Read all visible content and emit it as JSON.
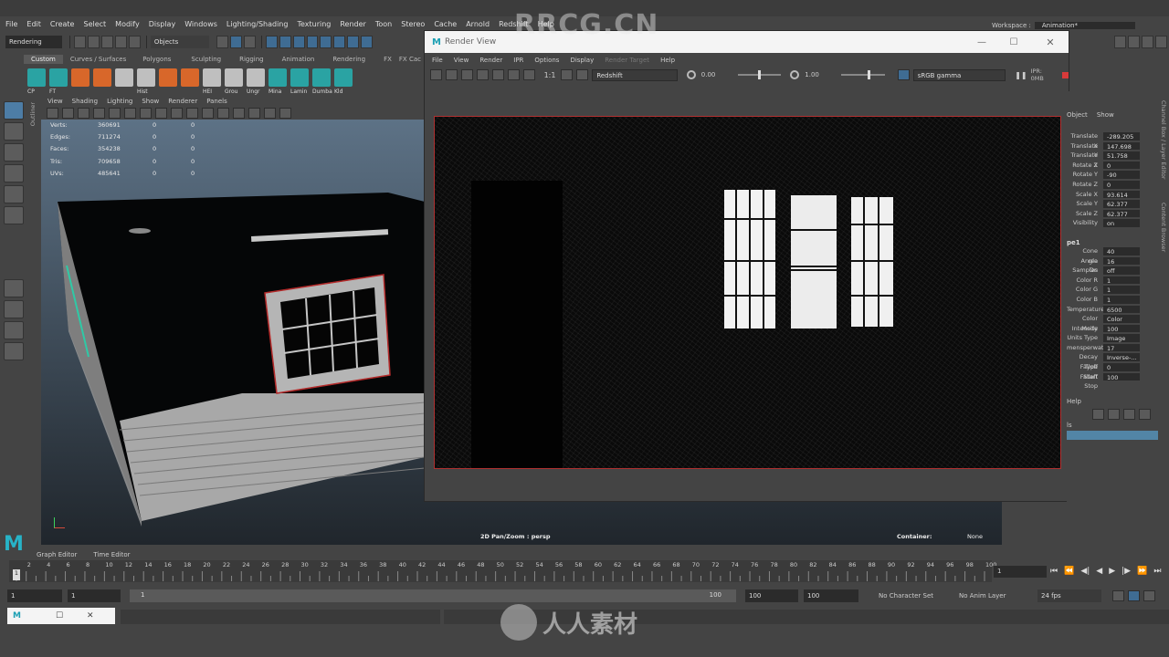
{
  "app": {
    "menus": [
      "File",
      "Edit",
      "Create",
      "Select",
      "Modify",
      "Display",
      "Windows",
      "Lighting/Shading",
      "Texturing",
      "Render",
      "Toon",
      "Stereo",
      "Cache",
      "Arnold",
      "Redshift",
      "Help"
    ],
    "workspace_label": "Workspace :",
    "workspace_value": "Animation*"
  },
  "status_line": {
    "menu_set": "Rendering",
    "selection_mode": "Objects"
  },
  "shelf": {
    "tabs": [
      "Custom",
      "Curves / Surfaces",
      "Polygons",
      "Sculpting",
      "Rigging",
      "Animation",
      "Rendering",
      "FX",
      "FX Cac"
    ],
    "active_tab": "Custom",
    "buttons": [
      "CP",
      "FT",
      "",
      "",
      "",
      "Hist",
      "",
      "",
      "HEI",
      "Grou",
      "Ungr",
      "Mina",
      "Lamin",
      "Dumba",
      "Kld"
    ]
  },
  "side_tabs": {
    "outliner": "Outliner",
    "channel_box": "Channel Box / Layer Editor",
    "content_browser": "Content Browser"
  },
  "viewport": {
    "menus": [
      "View",
      "Shading",
      "Lighting",
      "Show",
      "Renderer",
      "Panels"
    ],
    "hud": [
      {
        "label": "Verts:",
        "a": "360691",
        "b": "0",
        "c": "0"
      },
      {
        "label": "Edges:",
        "a": "711274",
        "b": "0",
        "c": "0"
      },
      {
        "label": "Faces:",
        "a": "354238",
        "b": "0",
        "c": "0"
      },
      {
        "label": "Tris:",
        "a": "709658",
        "b": "0",
        "c": "0"
      },
      {
        "label": "UVs:",
        "a": "485641",
        "b": "0",
        "c": "0"
      }
    ],
    "pan_zoom": "2D Pan/Zoom : persp",
    "container_label": "Container:",
    "container_value": "None"
  },
  "render_view": {
    "title": "Render View",
    "menus": [
      "File",
      "View",
      "Render",
      "IPR",
      "Options",
      "Display",
      "Render Target",
      "Help"
    ],
    "ratio_label": "1:1",
    "renderer": "Redshift",
    "exposure": "0.00",
    "gamma": "1.00",
    "color_space": "sRGB gamma",
    "ipr_label": "IPR: 0MB"
  },
  "channel_box": {
    "header": [
      "Object",
      "Show"
    ],
    "transform": [
      {
        "label": "Translate X",
        "value": "-289.205"
      },
      {
        "label": "Translate Y",
        "value": "147.698"
      },
      {
        "label": "Translate Z",
        "value": "51.758"
      },
      {
        "label": "Rotate X",
        "value": "0"
      },
      {
        "label": "Rotate Y",
        "value": "-90"
      },
      {
        "label": "Rotate Z",
        "value": "0"
      },
      {
        "label": "Scale X",
        "value": "93.614"
      },
      {
        "label": "Scale Y",
        "value": "62.377"
      },
      {
        "label": "Scale Z",
        "value": "62.377"
      },
      {
        "label": "Visibility",
        "value": "on"
      }
    ],
    "shape_header": "pe1",
    "shape_attrs": [
      {
        "label": "Cone Angle",
        "value": "40"
      },
      {
        "label": "rea Samples",
        "value": "16"
      },
      {
        "label": "On",
        "value": "off"
      },
      {
        "label": "Color R",
        "value": "1"
      },
      {
        "label": "Color G",
        "value": "1"
      },
      {
        "label": "Color B",
        "value": "1"
      },
      {
        "label": "Temperature",
        "value": "6500"
      },
      {
        "label": "Color Mode",
        "value": "Color"
      },
      {
        "label": "Intensity",
        "value": "100"
      },
      {
        "label": "Units Type",
        "value": "Image"
      },
      {
        "label": "mensperwatt",
        "value": "17"
      },
      {
        "label": "Decay Type",
        "value": "Inverse-..."
      },
      {
        "label": "Falloff Start",
        "value": "0"
      },
      {
        "label": "Falloff Stop",
        "value": "100"
      }
    ],
    "layer_help": "Help",
    "layer_item": "ls"
  },
  "bottom_tabs": [
    "Graph Editor",
    "Time Editor"
  ],
  "timeline": {
    "ticks": [
      "1",
      "2",
      "4",
      "6",
      "8",
      "10",
      "12",
      "14",
      "16",
      "18",
      "20",
      "22",
      "24",
      "26",
      "28",
      "30",
      "32",
      "34",
      "36",
      "38",
      "40",
      "42",
      "44",
      "46",
      "48",
      "50",
      "52",
      "54",
      "56",
      "58",
      "60",
      "62",
      "64",
      "66",
      "68",
      "70",
      "72",
      "74",
      "76",
      "78",
      "80",
      "82",
      "84",
      "86",
      "88",
      "90",
      "92",
      "94",
      "96",
      "98",
      "100"
    ],
    "current_frame": "1",
    "current_frame_field": "1"
  },
  "range": {
    "start": "1",
    "inner_start": "1",
    "slider_start": "1",
    "slider_end": "100",
    "end": "100",
    "anim_end": "100",
    "character_set": "No Character Set",
    "anim_layer": "No Anim Layer",
    "fps": "24 fps"
  },
  "watermark": {
    "top": "RRCG.CN",
    "bottom": "人人素材"
  }
}
